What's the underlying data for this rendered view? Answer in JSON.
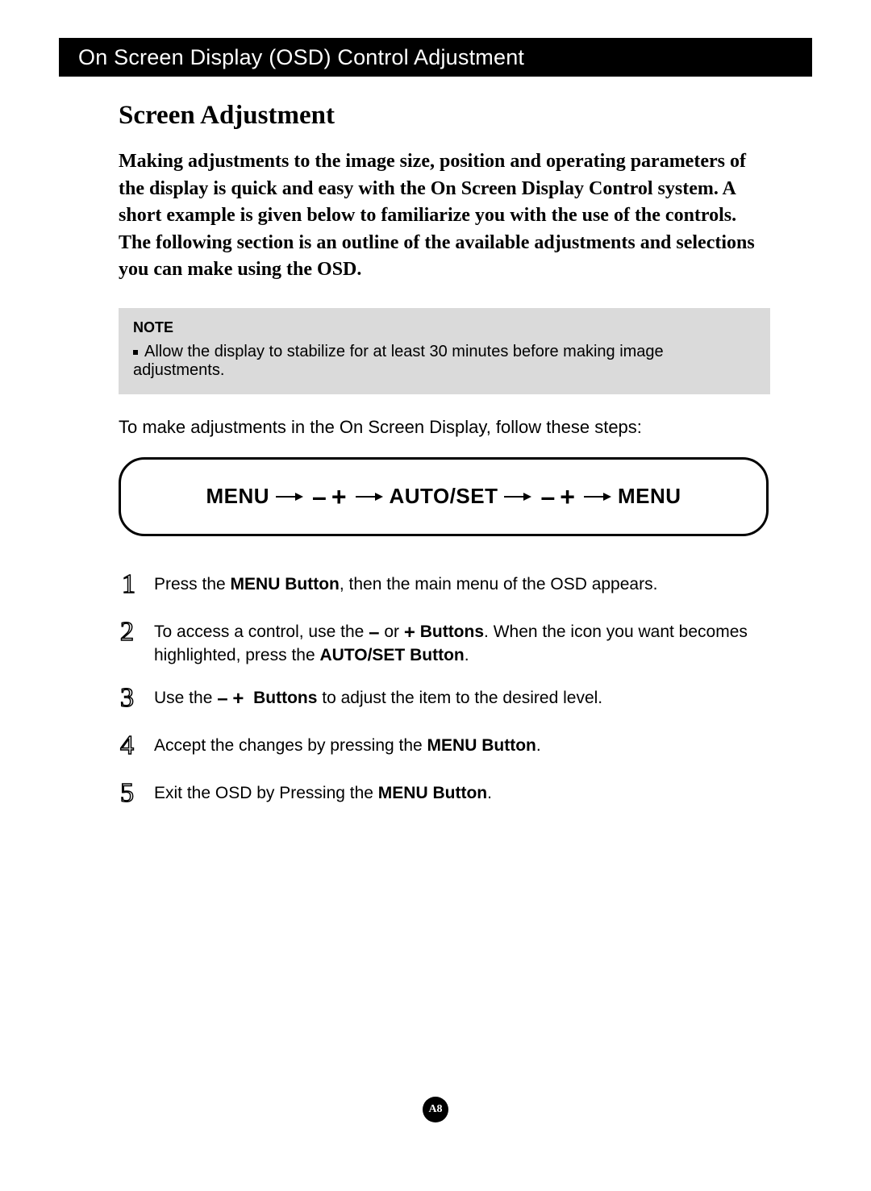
{
  "header": "On Screen Display (OSD) Control Adjustment",
  "section_title": "Screen Adjustment",
  "intro": "Making adjustments to the image size, position and operating parameters of the display is quick and easy with the On Screen Display Control system. A short example is given below to familiarize you with the use of the controls. The following section is an outline of the available adjustments and selections you can make using the OSD.",
  "note": {
    "label": "NOTE",
    "text": "Allow the display to stabilize for at least 30 minutes before making image adjustments."
  },
  "steps_intro": "To make adjustments in the On Screen Display, follow these steps:",
  "flow": {
    "menu1": "MENU",
    "autoset": "AUTO/SET",
    "menu2": "MENU"
  },
  "steps": {
    "s1a": "Press the ",
    "s1b": "MENU Button",
    "s1c": ", then the main menu of the OSD appears.",
    "s2a": "To access a control, use the  ",
    "s2b": " or  ",
    "s2c": "Buttons",
    "s2d": ". When the icon you want becomes highlighted, press the ",
    "s2e": "AUTO/SET Button",
    "s2f": ".",
    "s3a": "Use the  ",
    "s3b": "Buttons",
    "s3c": " to adjust the item to the desired level.",
    "s4a": "Accept the changes by pressing the ",
    "s4b": "MENU Button",
    "s4c": ".",
    "s5a": "Exit the OSD by Pressing the ",
    "s5b": "MENU Button",
    "s5c": "."
  },
  "symbols": {
    "minus": "–",
    "plus": "+"
  },
  "page_number": "A8"
}
